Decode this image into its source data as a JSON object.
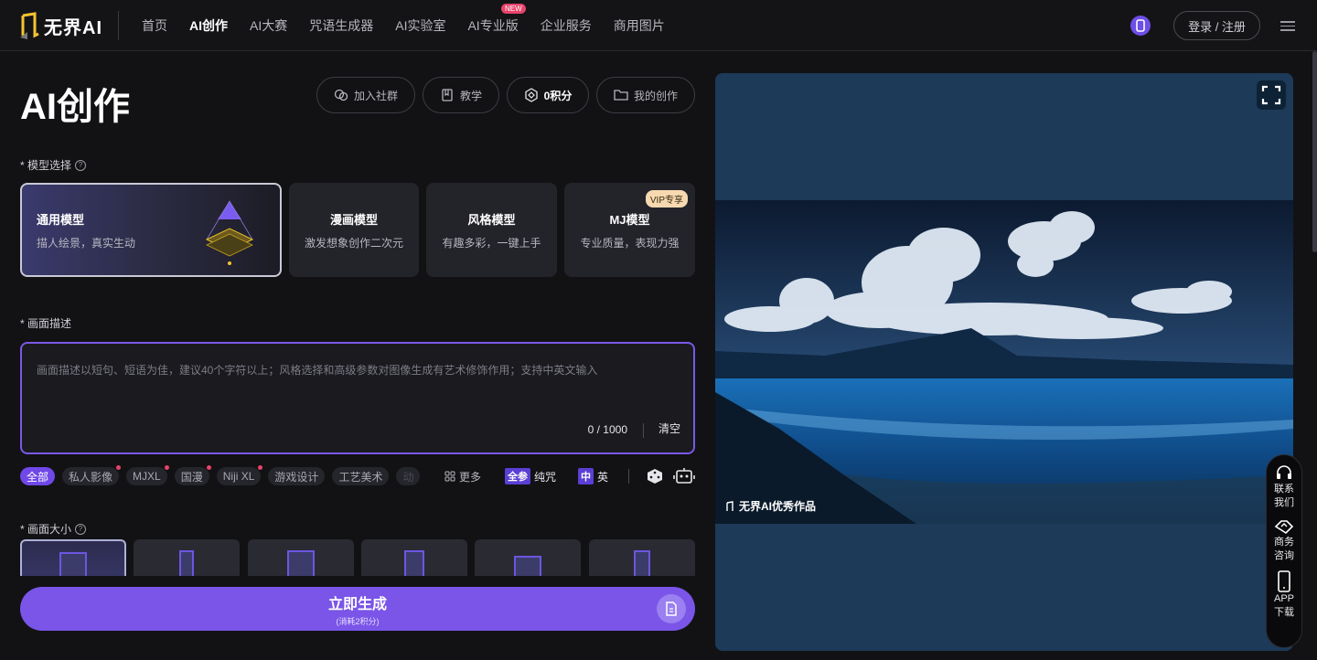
{
  "logo": {
    "text": "无界AI"
  },
  "nav": {
    "items": [
      {
        "label": "首页",
        "active": false
      },
      {
        "label": "AI创作",
        "active": true
      },
      {
        "label": "AI大赛",
        "active": false
      },
      {
        "label": "咒语生成器",
        "active": false
      },
      {
        "label": "AI实验室",
        "active": false
      },
      {
        "label": "AI专业版",
        "active": false,
        "badge": "NEW"
      },
      {
        "label": "企业服务",
        "active": false
      },
      {
        "label": "商用图片",
        "active": false
      }
    ],
    "login_label": "登录 / 注册"
  },
  "main": {
    "title": "AI创作",
    "actions": {
      "join": "加入社群",
      "tutorial": "教学",
      "points": "0积分",
      "my_works": "我的创作"
    },
    "model_section_label": "* 模型选择",
    "models": [
      {
        "title": "通用模型",
        "desc": "描人绘景，真实生动",
        "active": true
      },
      {
        "title": "漫画模型",
        "desc": "激发想象创作二次元",
        "active": false
      },
      {
        "title": "风格模型",
        "desc": "有趣多彩，一键上手",
        "active": false
      },
      {
        "title": "MJ模型",
        "desc": "专业质量，表现力强",
        "active": false,
        "badge": "VIP专享"
      }
    ],
    "desc_section_label": "* 画面描述",
    "description": {
      "placeholder": "画面描述以短句、短语为佳，建议40个字符以上；风格选择和高级参数对图像生成有艺术修饰作用；支持中英文输入",
      "value": "",
      "count": "0 / 1000",
      "clear": "清空"
    },
    "tags": [
      "全部",
      "私人影像",
      "MJXL",
      "国漫",
      "Niji XL",
      "游戏设计",
      "工艺美术",
      "动"
    ],
    "more_label": "更多",
    "spell_chip": "全参",
    "spell_label": "纯咒",
    "lang_chip": "中",
    "lang_label": "英",
    "size_section_label": "* 画面大小",
    "generate": {
      "label": "立即生成",
      "sub": "(消耗2积分)"
    }
  },
  "preview": {
    "caption": "无界AI优秀作品"
  },
  "float_menu": {
    "contact": "联系我们",
    "business": "商务咨询",
    "app": "APP下载"
  },
  "colors": {
    "accent": "#7a55e8",
    "background": "#121215",
    "badge": "#e8436b",
    "vip": "#f6d9b0"
  }
}
